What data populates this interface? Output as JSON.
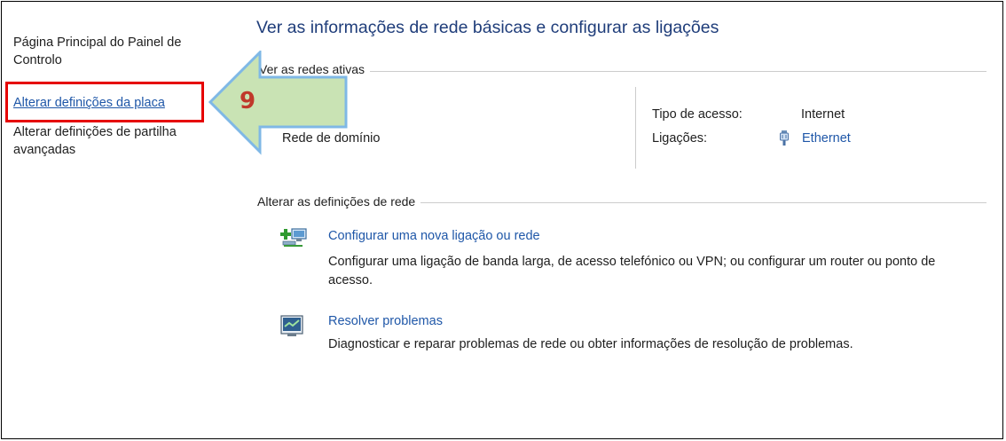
{
  "sidebar": {
    "home_link": "Página Principal do Painel de Controlo",
    "change_adapter_link": "Alterar definições da placa",
    "change_sharing_link": "Alterar definições de partilha avançadas"
  },
  "annotation": {
    "step_number": "9"
  },
  "main": {
    "title": "Ver as informações de rede básicas e configurar as ligações",
    "active_networks_heading": "Ver as redes ativas",
    "network_name": "Rede de domínio",
    "access_type_label": "Tipo de acesso:",
    "access_type_value": "Internet",
    "connections_label": "Ligações:",
    "connections_value": "Ethernet",
    "change_settings_heading": "Alterar as definições de rede",
    "new_connection": {
      "title": "Configurar uma nova ligação ou rede",
      "description": "Configurar uma ligação de banda larga, de acesso telefónico ou VPN; ou configurar um router ou ponto de acesso."
    },
    "troubleshoot": {
      "title": "Resolver problemas",
      "description": "Diagnosticar e reparar problemas de rede ou obter informações de resolução de problemas."
    }
  },
  "colors": {
    "link": "#1f57a8",
    "title": "#1f3d7a",
    "highlight": "#e60000",
    "arrow_fill": "#c9e3b4",
    "arrow_stroke": "#7fb8e6"
  }
}
